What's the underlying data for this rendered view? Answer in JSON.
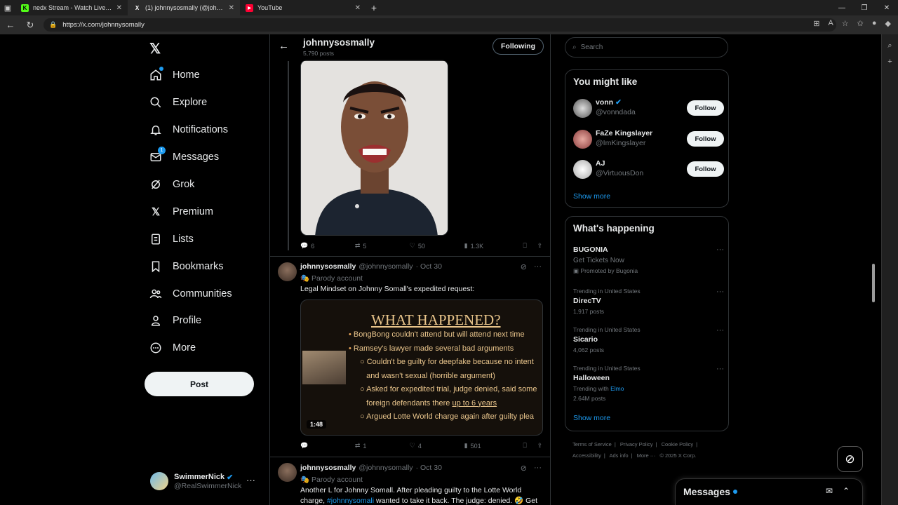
{
  "browser": {
    "tabs": [
      {
        "title": "nedx Stream - Watch Live on Kick",
        "favicon": "K",
        "favicon_color": "#53fc18"
      },
      {
        "title": "(1) johnnysosmally (@johnnyso...",
        "favicon": "X",
        "favicon_color": "#ffffff"
      },
      {
        "title": "YouTube",
        "favicon": "▶",
        "favicon_color": "#ff0033"
      }
    ],
    "url": "https://x.com/johnnysomally"
  },
  "nav": {
    "items": [
      {
        "label": "Home",
        "icon": "home-icon"
      },
      {
        "label": "Explore",
        "icon": "search-icon"
      },
      {
        "label": "Notifications",
        "icon": "bell-icon"
      },
      {
        "label": "Messages",
        "icon": "mail-icon",
        "badge": "1"
      },
      {
        "label": "Grok",
        "icon": "grok-icon"
      },
      {
        "label": "Premium",
        "icon": "x-icon"
      },
      {
        "label": "Lists",
        "icon": "list-icon"
      },
      {
        "label": "Bookmarks",
        "icon": "bookmark-icon"
      },
      {
        "label": "Communities",
        "icon": "people-icon"
      },
      {
        "label": "Profile",
        "icon": "person-icon"
      },
      {
        "label": "More",
        "icon": "more-circle-icon"
      }
    ],
    "post_label": "Post"
  },
  "account": {
    "name": "SwimmerNick",
    "handle": "@RealSwimmerNick"
  },
  "profile_header": {
    "name": "johnnysosmally",
    "posts": "5,790 posts",
    "following_label": "Following"
  },
  "tweets": [
    {
      "replies": "6",
      "reposts": "5",
      "likes": "50",
      "views": "1.3K"
    },
    {
      "name": "johnnysosmally",
      "handle": "@johnnysomally",
      "date": "· Oct 30",
      "parody": "Parody account",
      "text": "Legal Mindset on Johnny Somall's expedited request:",
      "video": {
        "title": "WHAT HAPPENED?",
        "bullets": [
          "BongBong couldn't attend but will attend next time",
          "Ramsey's lawyer made several bad arguments",
          "Couldn't be guilty for deepfake because no intent",
          "and wasn't sexual (horrible argument)",
          "Asked for expedited trial, judge denied, said some",
          "foreign defendants there",
          "up to 6 years",
          "Argued Lotte World charge again after guilty plea"
        ],
        "duration": "1:48"
      },
      "replies": "",
      "reposts": "1",
      "likes": "4",
      "views": "501"
    },
    {
      "name": "johnnysosmally",
      "handle": "@johnnysomally",
      "date": "· Oct 30",
      "parody": "Parody account",
      "text_a": "Another L for Johnny Somall. After pleading guilty to the Lotte World",
      "text_b": "charge,",
      "hashtag": "#johnnysomali",
      "text_c": "wanted to take it back. The judge: denied. 🤣 Get"
    }
  ],
  "search": {
    "placeholder": "Search"
  },
  "you_might_like": {
    "title": "You might like",
    "people": [
      {
        "name": "vonn",
        "handle": "@vonndada",
        "verified": true
      },
      {
        "name": "FaZe Kingslayer",
        "handle": "@ImKingslayer",
        "verified": false
      },
      {
        "name": "AJ",
        "handle": "@VirtuousDon",
        "verified": false
      }
    ],
    "follow_label": "Follow",
    "show_more": "Show more"
  },
  "whats_happening": {
    "title": "What's happening",
    "trends": [
      {
        "meta": "",
        "name": "BUGONIA",
        "line2": "Get Tickets Now",
        "line3": "Promoted by Bugonia"
      },
      {
        "meta": "Trending in United States",
        "name": "DirecTV",
        "line2": "1,917 posts"
      },
      {
        "meta": "Trending in United States",
        "name": "Sicario",
        "line2": "4,062 posts"
      },
      {
        "meta": "Trending in United States",
        "name": "Halloween",
        "with_prefix": "Trending with",
        "with": "Elmo",
        "line2": "2.64M posts"
      }
    ],
    "show_more": "Show more"
  },
  "footer": {
    "links": [
      "Terms of Service",
      "|",
      "Privacy Policy",
      "|",
      "Cookie Policy",
      "|",
      "Accessibility",
      "|",
      "Ads info",
      "|",
      "More ···",
      "© 2025 X Corp."
    ]
  },
  "messages_drawer": {
    "title": "Messages"
  }
}
